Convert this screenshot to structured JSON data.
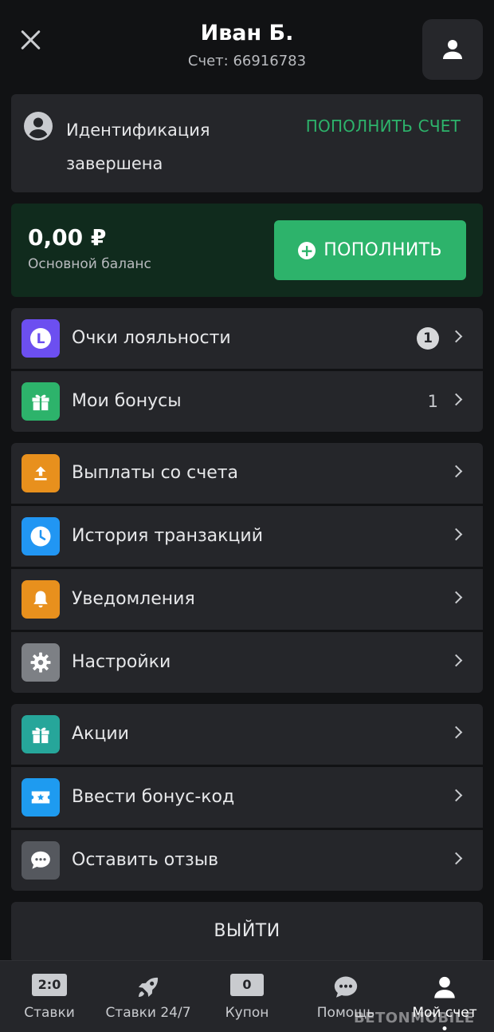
{
  "header": {
    "user_name": "Иван Б.",
    "account_line": "Счет: 66916783"
  },
  "identification": {
    "line1": "Идентификация",
    "line2": "завершена",
    "topup_link": "ПОПОЛНИТЬ СЧЕТ"
  },
  "balance": {
    "amount": "0,00 ₽",
    "label": "Основной баланс",
    "topup_button": "ПОПОЛНИТЬ"
  },
  "menu": {
    "group1": [
      {
        "label": "Очки лояльности",
        "icon": "loyalty-icon",
        "badge": "1"
      },
      {
        "label": "Мои бонусы",
        "icon": "gift-icon",
        "count": "1"
      }
    ],
    "group2": [
      {
        "label": "Выплаты со счета",
        "icon": "withdraw-icon"
      },
      {
        "label": "История транзакций",
        "icon": "clock-icon"
      },
      {
        "label": "Уведомления",
        "icon": "bell-icon"
      },
      {
        "label": "Настройки",
        "icon": "gear-icon"
      }
    ],
    "group3": [
      {
        "label": "Акции",
        "icon": "gift-icon"
      },
      {
        "label": "Ввести бонус-код",
        "icon": "ticket-icon"
      },
      {
        "label": "Оставить отзыв",
        "icon": "chat-bubble-icon"
      }
    ]
  },
  "logout_label": "ВЫЙТИ",
  "bottom_nav": [
    {
      "label": "Ставки",
      "icon": "score-icon",
      "icon_text": "2:0"
    },
    {
      "label": "Ставки 24/7",
      "icon": "rocket-icon"
    },
    {
      "label": "Купон",
      "icon": "coupon-icon",
      "icon_text": "0"
    },
    {
      "label": "Помощь",
      "icon": "chat-bubble-icon"
    },
    {
      "label": "Мой счет",
      "icon": "user-icon",
      "active": true
    }
  ],
  "watermark": "BETONMOBILE",
  "colors": {
    "background": "#111214",
    "card": "#25262a",
    "accent_green": "#2db36b",
    "balance_card": "#102b1d",
    "loyalty_purple": "#6c4ff0",
    "bonus_green": "#2db36b",
    "withdraw_orange": "#e8901d",
    "history_blue": "#2196f3",
    "notify_orange": "#e8901d",
    "settings_gray": "#7d8085",
    "promo_teal": "#26a69a",
    "code_blue": "#1e9bf0",
    "feedback_gray": "#55585e"
  }
}
